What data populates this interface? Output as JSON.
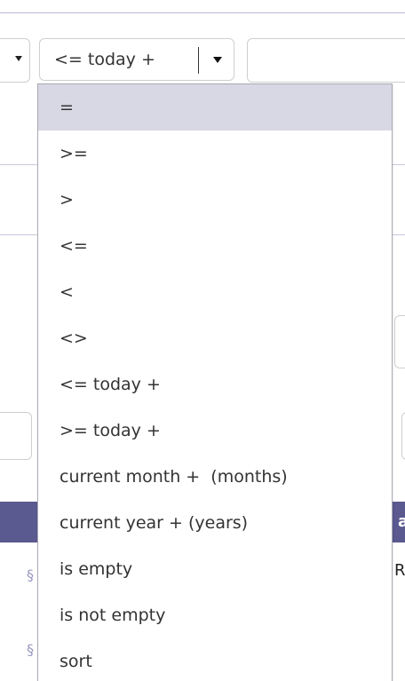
{
  "operator_select": {
    "value": "<= today +"
  },
  "dropdown": {
    "selected_index": 0,
    "options": [
      "=",
      ">=",
      ">",
      "<=",
      "<",
      "<>",
      "<= today +",
      ">= today +",
      "current month +  (months)",
      "current year + (years)",
      "is empty",
      "is not empty",
      "sort"
    ]
  },
  "table": {
    "header_fragment": "a",
    "row_fragment": "R"
  },
  "colors": {
    "header_bar": "#5a5990",
    "selected_option_bg": "#d8d8e4",
    "border": "#cfcfcf"
  }
}
